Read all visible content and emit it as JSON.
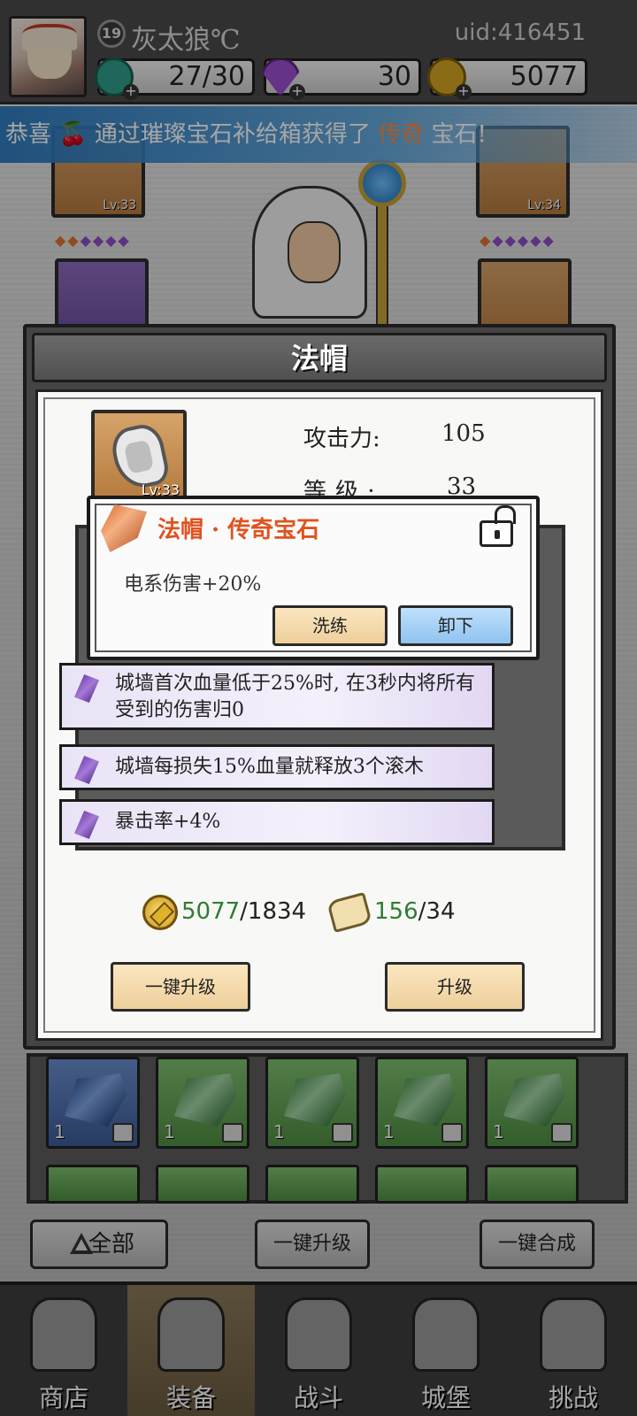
{
  "header": {
    "player_level": "19",
    "player_name": "灰太狼℃",
    "uid": "uid:416451",
    "energy": "27/30",
    "gems": "30",
    "gold": "5077"
  },
  "banner": {
    "prefix": "恭喜",
    "middle": "通过璀璨宝石补给箱获得了",
    "highlight": "传奇",
    "suffix": "宝石!"
  },
  "background_slots": {
    "left_top_lv": "Lv:33",
    "right_top_lv": "Lv:34"
  },
  "modal": {
    "title": "法帽",
    "item_level_badge": "Lv:33",
    "stats": [
      {
        "label": "攻击力:",
        "value": "105"
      },
      {
        "label": "等级:",
        "value": "33"
      }
    ],
    "affixes": [
      "城墙首次血量低于25%时, 在3秒内将所有受到的伤害归0",
      "城墙每损失15%血量就释放3个滚木",
      "暴击率+4%"
    ],
    "costs": {
      "gold_have": "5077",
      "gold_need": "/1834",
      "scroll_have": "156",
      "scroll_need": "/34"
    },
    "buttons": {
      "upgrade_all": "一键升级",
      "upgrade": "升级"
    }
  },
  "gem_popup": {
    "title": "法帽 · 传奇宝石",
    "description": "电系伤害+20%",
    "wash_label": "洗练",
    "remove_label": "卸下"
  },
  "inventory": {
    "counts": [
      "1",
      "1",
      "1",
      "1",
      "1"
    ]
  },
  "actions": {
    "all_label": "全部",
    "upgrade_all_label": "一键升级",
    "merge_all_label": "一键合成"
  },
  "nav": [
    {
      "label": "商店"
    },
    {
      "label": "装备"
    },
    {
      "label": "战斗"
    },
    {
      "label": "城堡"
    },
    {
      "label": "挑战"
    }
  ],
  "colors": {
    "legendary": "#e0531f",
    "sufficient": "#2e7d32",
    "banner_blue": "#2878be"
  }
}
